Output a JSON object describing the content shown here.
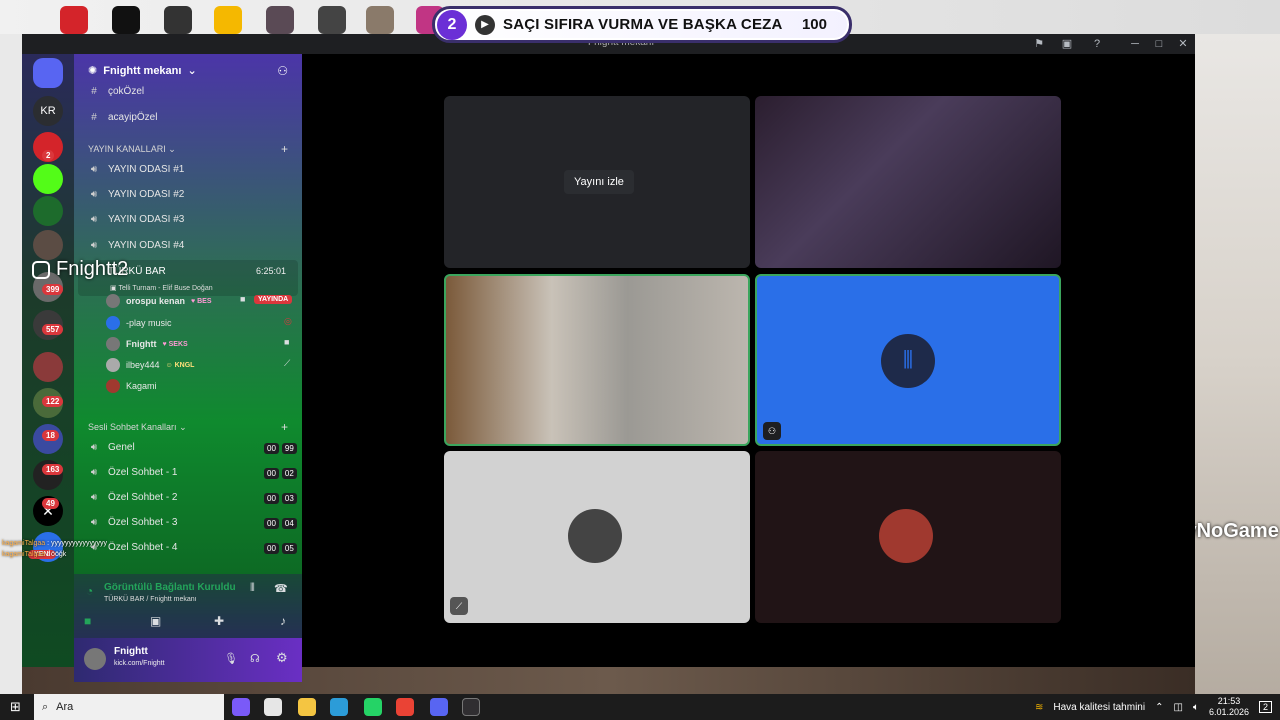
{
  "alert": {
    "count": "2",
    "text": "SAÇI SIFIRA VURMA VE BAŞKA CEZA",
    "value": "100"
  },
  "window": {
    "title": "Fnightt mekanı"
  },
  "server": {
    "name": "Fnightt mekanı",
    "rail_label": "KR"
  },
  "overlay": {
    "streamer_name": "Fnightt2"
  },
  "text_channels": [
    {
      "name": "çokÖzel"
    },
    {
      "name": "acayipÖzel"
    }
  ],
  "stream_category": {
    "label": "YAYIN KANALLARI"
  },
  "stream_channels": [
    {
      "name": "YAYIN ODASI #1"
    },
    {
      "name": "YAYIN ODASI #2"
    },
    {
      "name": "YAYIN ODASI #3"
    },
    {
      "name": "YAYIN ODASI #4"
    }
  ],
  "active_voice": {
    "name": "TÜRKÜ BAR",
    "timer": "6:25:01",
    "activity": "Telli Turnam - Elif Buse Doğan",
    "users": [
      {
        "name": "orospu kenan",
        "tag": "BES",
        "live": "YAYINDA"
      },
      {
        "name": "-play music",
        "tag": ""
      },
      {
        "name": "Fnightt",
        "tag": "SEKS"
      },
      {
        "name": "ilbey444",
        "tag": "KNGL"
      },
      {
        "name": "Kagami",
        "tag": ""
      }
    ]
  },
  "voice_category": {
    "label": "Sesli Sohbet Kanalları"
  },
  "voice_channels": [
    {
      "name": "Genel",
      "c1": "00",
      "c2": "99"
    },
    {
      "name": "Özel Sohbet - 1",
      "c1": "00",
      "c2": "02"
    },
    {
      "name": "Özel Sohbet - 2",
      "c1": "00",
      "c2": "03"
    },
    {
      "name": "Özel Sohbet - 3",
      "c1": "00",
      "c2": "04"
    },
    {
      "name": "Özel Sohbet - 4",
      "c1": "00",
      "c2": "05"
    }
  ],
  "chat_overlay": [
    {
      "user": "kagamiTalgaa",
      "text": "yyyyyyyyyyyyyyyy"
    },
    {
      "user": "kagamiTalgaa",
      "text": "ööğk"
    }
  ],
  "new_badge": "YENİ",
  "rail_badges": [
    "2",
    "399",
    "557",
    "122",
    "18",
    "163",
    "49"
  ],
  "voice_status": {
    "title": "Görüntülü Bağlantı Kuruldu",
    "subtitle": "TÜRKÜ BAR / Fnightt mekanı"
  },
  "user_panel": {
    "name": "Fnightt",
    "status": "kick.com/Fnightt"
  },
  "stage": {
    "watch_label": "Yayını izle"
  },
  "brand_watermark": "ByNoGame",
  "taskbar": {
    "search_placeholder": "Ara",
    "weather": "Hava kalitesi tahmini",
    "time": "21:53",
    "date": "6.01.2026",
    "notif": "2"
  }
}
